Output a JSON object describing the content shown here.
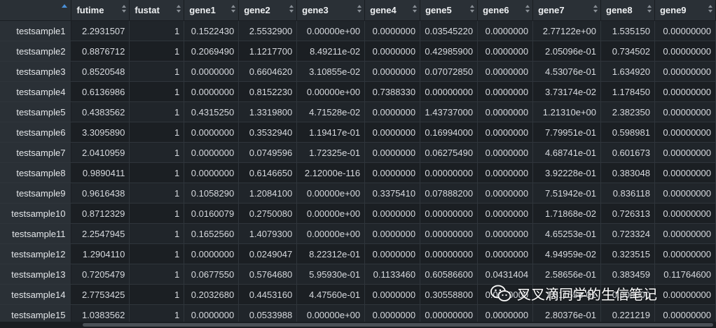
{
  "columns": [
    {
      "label": "",
      "width": 102
    },
    {
      "label": "futime",
      "width": 83
    },
    {
      "label": "fustat",
      "width": 78
    },
    {
      "label": "gene1",
      "width": 78
    },
    {
      "label": "gene2",
      "width": 83
    },
    {
      "label": "gene3",
      "width": 97
    },
    {
      "label": "gene4",
      "width": 79
    },
    {
      "label": "gene5",
      "width": 82
    },
    {
      "label": "gene6",
      "width": 79
    },
    {
      "label": "gene7",
      "width": 97
    },
    {
      "label": "gene8",
      "width": 77
    },
    {
      "label": "gene9",
      "width": 87
    }
  ],
  "rows": [
    [
      "testsample1",
      "2.2931507",
      "1",
      "0.1522430",
      "2.5532900",
      "0.00000e+00",
      "0.0000000",
      "0.03545220",
      "0.0000000",
      "2.77122e+00",
      "1.535150",
      "0.00000000"
    ],
    [
      "testsample2",
      "0.8876712",
      "1",
      "0.2069490",
      "1.1217700",
      "8.49211e-02",
      "0.0000000",
      "0.42985900",
      "0.0000000",
      "2.05096e-01",
      "0.734502",
      "0.00000000"
    ],
    [
      "testsample3",
      "0.8520548",
      "1",
      "0.0000000",
      "0.6604620",
      "3.10855e-02",
      "0.0000000",
      "0.07072850",
      "0.0000000",
      "4.53076e-01",
      "1.634920",
      "0.00000000"
    ],
    [
      "testsample4",
      "0.6136986",
      "1",
      "0.0000000",
      "0.8152230",
      "0.00000e+00",
      "0.7388330",
      "0.00000000",
      "0.0000000",
      "3.73174e-02",
      "1.178450",
      "0.00000000"
    ],
    [
      "testsample5",
      "0.4383562",
      "1",
      "0.4315250",
      "1.3319800",
      "4.71528e-02",
      "0.0000000",
      "1.43737000",
      "0.0000000",
      "1.21310e+00",
      "2.382350",
      "0.00000000"
    ],
    [
      "testsample6",
      "3.3095890",
      "1",
      "0.0000000",
      "0.3532940",
      "1.19417e-01",
      "0.0000000",
      "0.16994000",
      "0.0000000",
      "7.79951e-01",
      "0.598981",
      "0.00000000"
    ],
    [
      "testsample7",
      "2.0410959",
      "1",
      "0.0000000",
      "0.0749596",
      "1.72325e-01",
      "0.0000000",
      "0.06275490",
      "0.0000000",
      "4.68741e-01",
      "0.601673",
      "0.00000000"
    ],
    [
      "testsample8",
      "0.9890411",
      "1",
      "0.0000000",
      "0.6146650",
      "2.12000e-116",
      "0.0000000",
      "0.00000000",
      "0.0000000",
      "3.92228e-01",
      "0.383048",
      "0.00000000"
    ],
    [
      "testsample9",
      "0.9616438",
      "1",
      "0.1058290",
      "1.2084100",
      "0.00000e+00",
      "0.3375410",
      "0.07888200",
      "0.0000000",
      "7.51942e-01",
      "0.836118",
      "0.00000000"
    ],
    [
      "testsample10",
      "0.8712329",
      "1",
      "0.0160079",
      "0.2750080",
      "0.00000e+00",
      "0.0000000",
      "0.00000000",
      "0.0000000",
      "1.71868e-02",
      "0.726313",
      "0.00000000"
    ],
    [
      "testsample11",
      "2.2547945",
      "1",
      "0.1652560",
      "1.4079300",
      "0.00000e+00",
      "0.0000000",
      "0.00000000",
      "0.0000000",
      "4.65253e-01",
      "0.723324",
      "0.00000000"
    ],
    [
      "testsample12",
      "1.2904110",
      "1",
      "0.0000000",
      "0.0249047",
      "8.22312e-01",
      "0.0000000",
      "0.00000000",
      "0.0000000",
      "4.94959e-02",
      "0.323515",
      "0.00000000"
    ],
    [
      "testsample13",
      "0.7205479",
      "1",
      "0.0677550",
      "0.5764680",
      "5.95930e-01",
      "0.1133460",
      "0.60586600",
      "0.0431404",
      "2.58656e-01",
      "0.383459",
      "0.11764600"
    ],
    [
      "testsample14",
      "2.7753425",
      "1",
      "0.2032680",
      "0.4453160",
      "4.47560e-01",
      "0.0000000",
      "0.30558800",
      "0.0000000",
      "1.81155e-01",
      "0.000000",
      "0.00000000"
    ],
    [
      "testsample15",
      "1.0383562",
      "1",
      "0.0000000",
      "0.0533988",
      "0.00000e+00",
      "0.0000000",
      "0.00000000",
      "0.0000000",
      "2.80376e-01",
      "0.221219",
      "0.00000000"
    ]
  ],
  "watermark": {
    "text": "叉叉滴同学的生信笔记",
    "icon": "wechat-icon"
  },
  "colors": {
    "background": "#1e2328",
    "header": "#2a3036",
    "sort_active": "#4a90d9"
  }
}
